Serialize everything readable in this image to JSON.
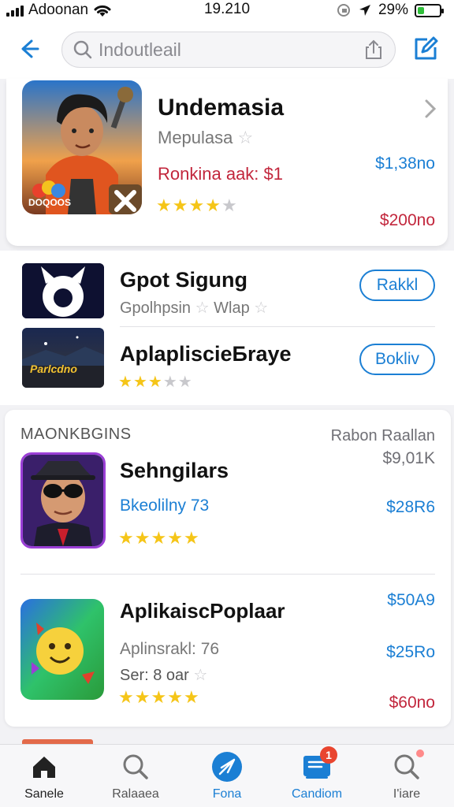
{
  "status_bar": {
    "carrier": "Adoonan",
    "time": "19.210",
    "battery": "29%",
    "battery_level": 0.29
  },
  "search": {
    "placeholder": "Indoutleail"
  },
  "featured": {
    "title": "Undemasia",
    "subtitle": "Mepulasa",
    "ranking": "Ronkina aak: $1",
    "price": "$1,38no",
    "price_red": "$200no",
    "icon_text": "DOQOOS",
    "rating": 4
  },
  "list": [
    {
      "title": "Gpot Sigung",
      "subtitle": "Gpolhpsin",
      "subtitle2": "Wlap",
      "action": "Rakkl"
    },
    {
      "title": "AplaplisciеБraye",
      "icon_text": "Parlcdno",
      "action": "Bokliv",
      "rating": 3
    }
  ],
  "section": {
    "heading": "MAONKBGINS",
    "right_heading": "Rabon Raallan",
    "right_sub": "$9,01K",
    "items": [
      {
        "title": "Sehngilars",
        "subtitle": "Bkeolilny 73",
        "price": "$28R6",
        "rating": 5
      },
      {
        "title": "AplikaiscPoplaar",
        "subtitle": "Aplinsrakl: 76",
        "subtitle2": "Ser: 8 oar",
        "price_top": "$50A9",
        "price": "$25Ro",
        "price_red": "$60no",
        "rating": 5
      }
    ]
  },
  "tabs": [
    {
      "label": "Sanele",
      "icon": "home-icon"
    },
    {
      "label": "Ralaaea",
      "icon": "search-icon"
    },
    {
      "label": "Fona",
      "icon": "compass-icon"
    },
    {
      "label": "Candiom",
      "icon": "updates-icon",
      "badge": "1"
    },
    {
      "label": "I'iare",
      "icon": "search-icon"
    }
  ],
  "colors": {
    "accent": "#1b7fd4",
    "price_red": "#c2263c",
    "star": "#f5c518",
    "badge": "#e9452f"
  }
}
